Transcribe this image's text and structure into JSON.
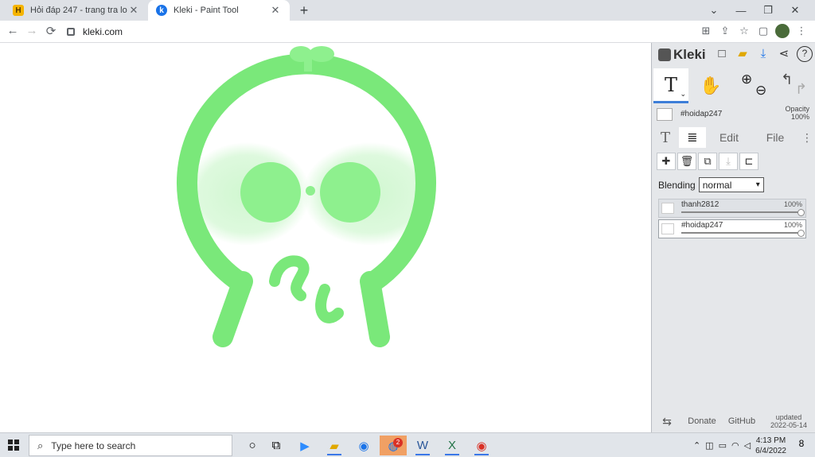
{
  "browser": {
    "tabs": [
      {
        "title": "Hỏi đáp 247 - trang tra loi",
        "icon": "h-icon",
        "active": false
      },
      {
        "title": "Kleki - Paint Tool",
        "icon": "kleki-icon",
        "active": true
      }
    ],
    "new_tab": "+",
    "url": "kleki.com",
    "window_controls": {
      "chevron": "⌄",
      "minimize": "—",
      "maximize": "❐",
      "close": "✕"
    },
    "nav": {
      "back": "←",
      "forward": "→",
      "reload": "⟳"
    },
    "toolbar_icons": {
      "translate": "⊞",
      "share": "⇪",
      "bookmark": "☆",
      "sidepanel": "▢",
      "menu": "⋮"
    }
  },
  "kleki": {
    "brand": "Kleki",
    "header_icons": {
      "new_image": "□",
      "import": "▰",
      "download": "⤓",
      "share": "⋖",
      "help": "?"
    },
    "tools": {
      "text": "T",
      "hand": "✋",
      "zoom_in": "⊕",
      "zoom_out": "⊖",
      "undo": "↰",
      "redo": "↱"
    },
    "current_layer_name": "#hoidap247",
    "opacity_label": "Opacity",
    "opacity_value": "100%",
    "panel_tabs": {
      "text": "T",
      "layers": "≣",
      "edit": "Edit",
      "file": "File",
      "more": "⋮"
    },
    "layer_buttons": {
      "add": "✚",
      "delete": "🗑",
      "duplicate": "⧉",
      "merge": "⤓",
      "rename": "⊏"
    },
    "blending_label": "Blending",
    "blending_value": "normal",
    "layers": [
      {
        "name": "thanh2812",
        "opacity": "100%",
        "selected": false
      },
      {
        "name": "#hoidap247",
        "opacity": "100%",
        "selected": true
      }
    ],
    "footer": {
      "swap": "⇆",
      "donate": "Donate",
      "github": "GitHub",
      "updated_label": "updated",
      "updated_date": "2022-05-14"
    },
    "drawing_color": "#7ae87a"
  },
  "taskbar": {
    "search_placeholder": "Type here to search",
    "clock_time": "4:13 PM",
    "clock_date": "6/4/2022",
    "badge_count": "2",
    "notification_count": "8",
    "apps": [
      "cortana-icon",
      "task-view-icon",
      "zoom-icon",
      "file-explorer-icon",
      "edge-icon",
      "chat-app-icon",
      "word-icon",
      "excel-icon",
      "chrome-icon"
    ]
  }
}
